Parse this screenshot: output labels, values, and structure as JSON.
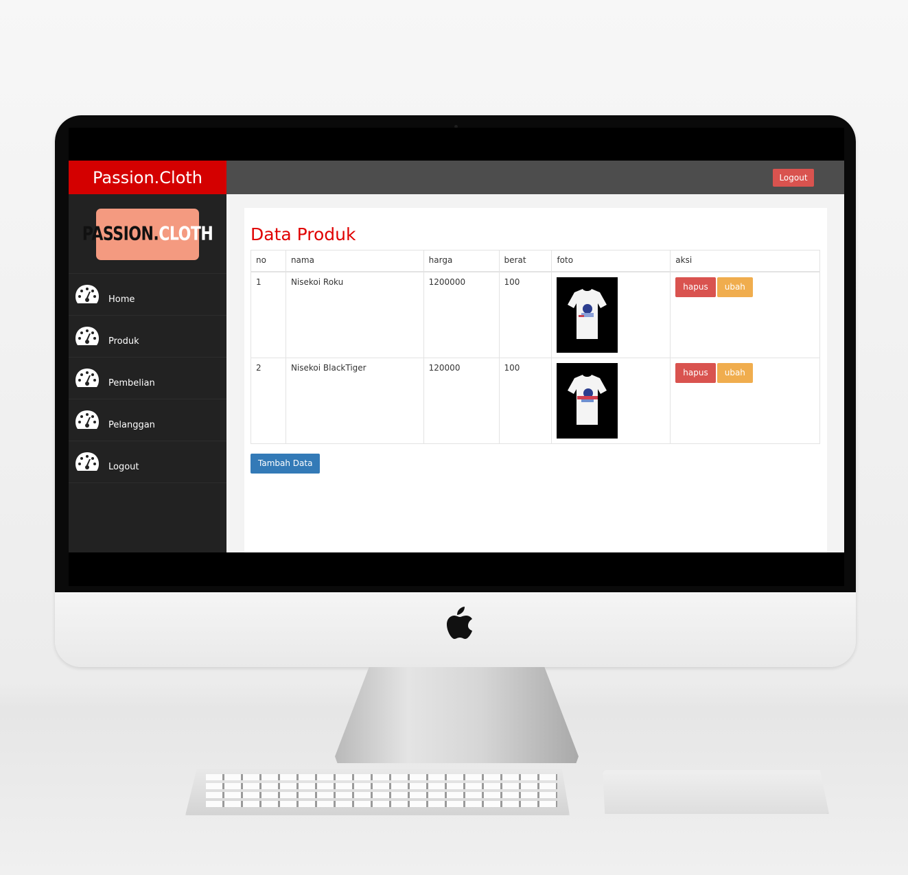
{
  "brand": "Passion.Cloth",
  "header": {
    "logout_label": "Logout"
  },
  "sidebar": {
    "logo": "PASSION.CLOTH",
    "items": [
      {
        "label": "Home",
        "icon": "dashboard-icon"
      },
      {
        "label": "Produk",
        "icon": "dashboard-icon"
      },
      {
        "label": "Pembelian",
        "icon": "dashboard-icon"
      },
      {
        "label": "Pelanggan",
        "icon": "dashboard-icon"
      },
      {
        "label": "Logout",
        "icon": "dashboard-icon"
      }
    ]
  },
  "main": {
    "title": "Data Produk",
    "table": {
      "columns": [
        "no",
        "nama",
        "harga",
        "berat",
        "foto",
        "aksi"
      ],
      "rows": [
        {
          "no": "1",
          "nama": "Nisekoi Roku",
          "harga": "1200000",
          "berat": "100",
          "foto": "tshirt-photo",
          "hapus": "hapus",
          "ubah": "ubah"
        },
        {
          "no": "2",
          "nama": "Nisekoi BlackTiger",
          "harga": "120000",
          "berat": "100",
          "foto": "tshirt-photo",
          "hapus": "hapus",
          "ubah": "ubah"
        }
      ]
    },
    "add_label": "Tambah Data"
  },
  "colors": {
    "brand_red": "#d40000",
    "topbar": "#4d4d4d",
    "sidebar": "#222222",
    "danger": "#d9534f",
    "warning": "#f0ad4e",
    "primary": "#337ab7",
    "logo_bg": "#f49a80"
  }
}
